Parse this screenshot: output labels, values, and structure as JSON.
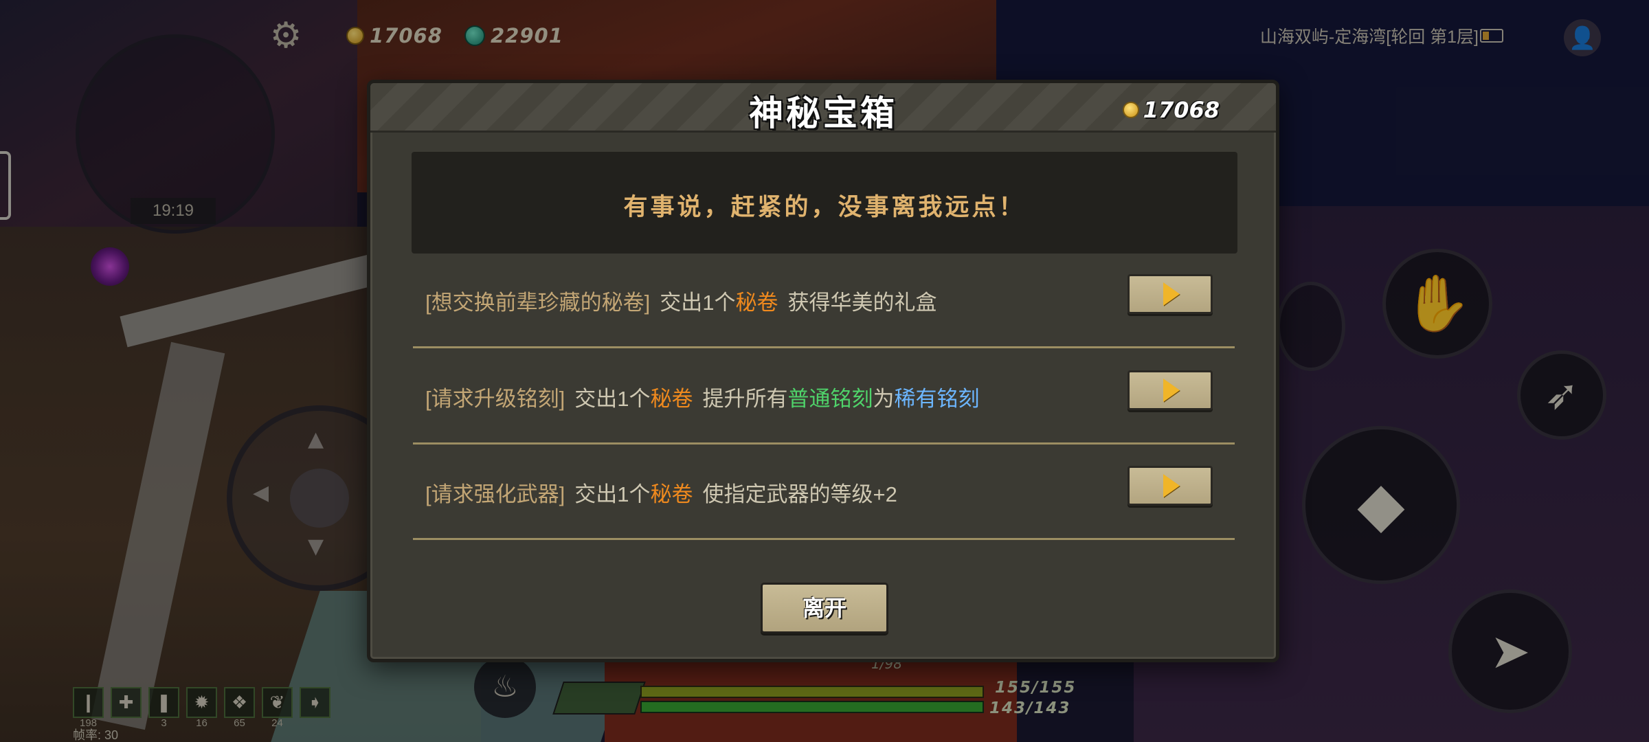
{
  "hud": {
    "gold": "17068",
    "gems": "22901",
    "location": "山海双屿-定海湾[轮回 第1层]",
    "timer": "19:19",
    "hp": "155/155",
    "mp": "143/143",
    "xp": "1/98",
    "fps_label": "帧率: 30",
    "inventory": [
      {
        "icon": "red-potion-icon",
        "glyph": "❙",
        "count": "198"
      },
      {
        "icon": "heal-cross-icon",
        "glyph": "✚",
        "count": ""
      },
      {
        "icon": "pink-scroll-icon",
        "glyph": "❚",
        "count": "3"
      },
      {
        "icon": "red-crystal-icon",
        "glyph": "✹",
        "count": "16"
      },
      {
        "icon": "purple-beast-icon",
        "glyph": "❖",
        "count": "65"
      },
      {
        "icon": "violet-feather-icon",
        "glyph": "❦",
        "count": "24"
      },
      {
        "icon": "next-arrow-icon",
        "glyph": "➧",
        "count": ""
      }
    ]
  },
  "dialog": {
    "title": "神秘宝箱",
    "gold": "17068",
    "npc_line": "有事说，赶紧的，没事离我远点！",
    "options": [
      {
        "bracket": "[想交换前辈珍藏的秘卷]",
        "prefix": "交出1个",
        "item": "秘卷",
        "result": "获得华美的礼盒"
      },
      {
        "bracket": "[请求升级铭刻]",
        "prefix": "交出1个",
        "item": "秘卷",
        "result_a": "提升所有",
        "common": "普通铭刻",
        "mid": "为",
        "rare": "稀有铭刻"
      },
      {
        "bracket": "[请求强化武器]",
        "prefix": "交出1个",
        "item": "秘卷",
        "result": "使指定武器的等级+2"
      }
    ],
    "leave_label": "离开"
  },
  "colors": {
    "accent_item": "#f08a1e",
    "common": "#4fd36a",
    "rare": "#6cb6ff",
    "npc_text": "#e0b36e",
    "button": "#c8bb96"
  }
}
